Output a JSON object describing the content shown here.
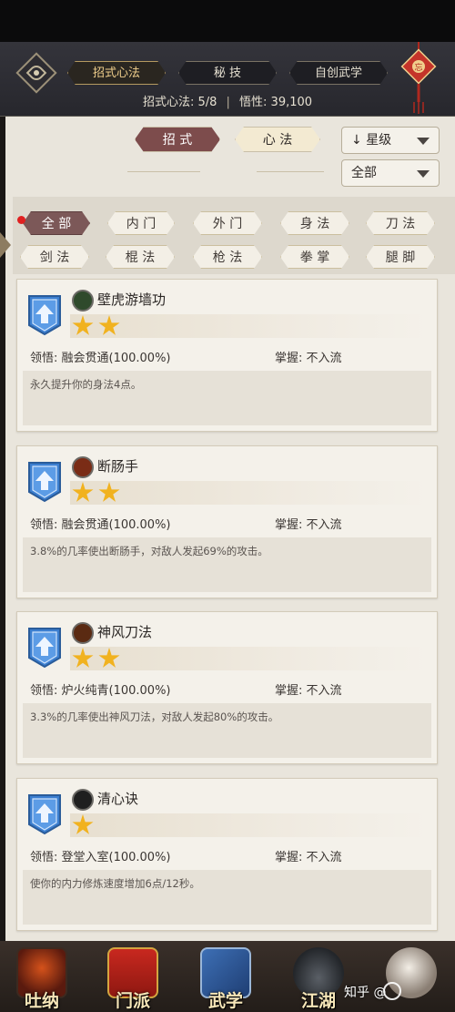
{
  "header": {
    "tabs": [
      {
        "label": "招式心法"
      },
      {
        "label": "秘 技"
      },
      {
        "label": "自创武学"
      }
    ],
    "info": {
      "moves_label": "招式心法: 5/8",
      "insight_label": "悟性: 39,100"
    },
    "icons": {
      "left": "eye-icon",
      "right": "knot-charm-icon"
    }
  },
  "toggles": [
    {
      "label": "招 式"
    },
    {
      "label": "心 法"
    }
  ],
  "sort_select": {
    "value": "星级",
    "prefix": "↓"
  },
  "filter_select": {
    "value": "全部"
  },
  "filter_chips": [
    {
      "label": "全 部"
    },
    {
      "label": "内 门"
    },
    {
      "label": "外 门"
    },
    {
      "label": "身 法"
    },
    {
      "label": "刀 法"
    },
    {
      "label": "剑 法"
    },
    {
      "label": "棍 法"
    },
    {
      "label": "枪 法"
    },
    {
      "label": "拳 掌"
    },
    {
      "label": "腿 脚"
    }
  ],
  "skills": [
    {
      "name": "壁虎游墙功",
      "stars": 2,
      "comprehension": "领悟:  融会贯通(100.00%)",
      "mastery": "掌握:  不入流",
      "description": "永久提升你的身法4点。",
      "icon": "gecko-skill-icon",
      "icon_color": "#2f4a2c"
    },
    {
      "name": "断肠手",
      "stars": 2,
      "comprehension": "领悟:  融会贯通(100.00%)",
      "mastery": "掌握:  不入流",
      "description": "3.8%的几率使出断肠手，对敌人发起69%的攻击。",
      "icon": "fist-skill-icon",
      "icon_color": "#7a2c16"
    },
    {
      "name": "神风刀法",
      "stars": 2,
      "comprehension": "领悟:  炉火纯青(100.00%)",
      "mastery": "掌握:  不入流",
      "description": "3.3%的几率使出神风刀法，对敌人发起80%的攻击。",
      "icon": "blade-skill-icon",
      "icon_color": "#5a2a12"
    },
    {
      "name": "清心诀",
      "stars": 1,
      "comprehension": "领悟:  登堂入室(100.00%)",
      "mastery": "掌握:  不入流",
      "description": "使你的内力修炼速度增加6点/12秒。",
      "icon": "yin-yang-icon",
      "icon_color": "#1f1f1f"
    }
  ],
  "bottom_nav": [
    {
      "label": "吐纳",
      "icon": "meditation-icon"
    },
    {
      "label": "门派",
      "icon": "sect-banner-icon"
    },
    {
      "label": "武学",
      "icon": "martial-book-icon"
    },
    {
      "label": "江湖",
      "icon": "hat-icon"
    },
    {
      "label": "",
      "icon": "horse-icon"
    }
  ],
  "watermark": {
    "text": "知乎 @"
  },
  "colors": {
    "star": "#f1b21f",
    "selected_chip": "#7c5858",
    "accent_gold": "#f0cf8c"
  }
}
